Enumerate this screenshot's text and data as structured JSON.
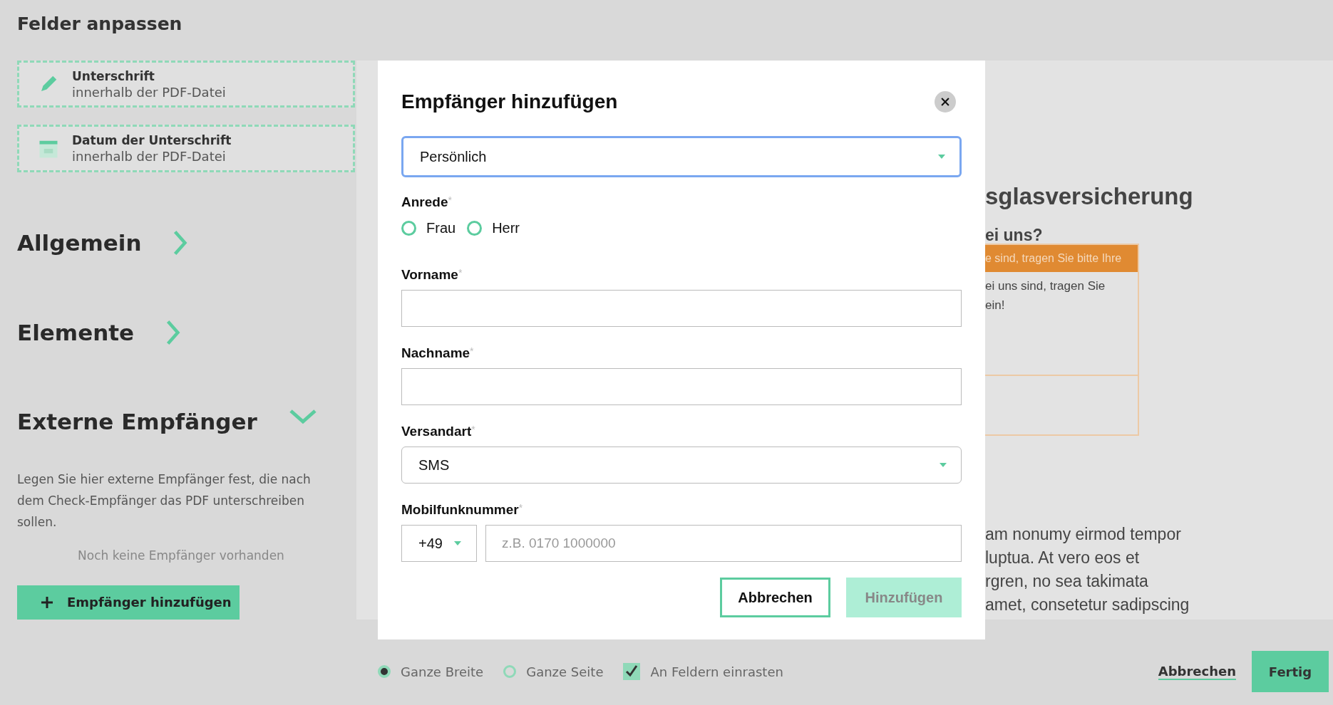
{
  "header": {
    "title": "Felder anpassen"
  },
  "field_cards": [
    {
      "kind": "signature",
      "title": "Unterschrift",
      "subtitle": "innerhalb der PDF-Datei"
    },
    {
      "kind": "date",
      "title": "Datum der Unterschrift",
      "subtitle": "innerhalb der PDF-Datei"
    }
  ],
  "sections": [
    {
      "title": "Allgemein",
      "expanded": false
    },
    {
      "title": "Elemente",
      "expanded": false
    },
    {
      "title": "Externe Empfänger",
      "expanded": true
    }
  ],
  "external_recipients": {
    "description": "Legen Sie hier externe Empfänger fest, die nach dem Check-Empfänger das PDF unterschreiben sollen.",
    "empty_text": "Noch keine Empfänger vorhanden",
    "add_button": "Empfänger hinzufügen"
  },
  "document": {
    "heading": "sglasversicherung",
    "question": "ei uns?",
    "banner": "e sind, tragen Sie bitte Ihre",
    "box_text": [
      "ei uns sind, tragen Sie",
      "ein!"
    ],
    "body_lines": [
      "am nonumy eirmod tempor",
      "luptua. At vero eos et",
      "rgren, no sea takimata",
      "amet, consetetur sadipscing"
    ]
  },
  "bottom_bar": {
    "view_options": [
      {
        "label": "Ganze Breite",
        "selected": true
      },
      {
        "label": "Ganze Seite",
        "selected": false
      }
    ],
    "snap": {
      "label": "An Feldern einrasten",
      "checked": true
    },
    "cancel": "Abbrechen",
    "done": "Fertig"
  },
  "modal": {
    "title": "Empfänger hinzufügen",
    "type_select": {
      "value": "Persönlich",
      "focused": true
    },
    "salutation": {
      "label": "Anrede",
      "required_mark": "*",
      "options": [
        {
          "label": "Frau",
          "selected": false
        },
        {
          "label": "Herr",
          "selected": false
        }
      ]
    },
    "first_name": {
      "label": "Vorname",
      "required_mark": "*"
    },
    "last_name": {
      "label": "Nachname",
      "required_mark": "*"
    },
    "delivery": {
      "label": "Versandart",
      "required_mark": "*",
      "value": "SMS"
    },
    "mobile": {
      "label": "Mobilfunknummer",
      "required_mark": "*",
      "country_code": "+49",
      "placeholder": "z.B. 0170 1000000"
    },
    "cancel": "Abbrechen",
    "submit": {
      "label": "Hinzufügen",
      "disabled": true
    }
  }
}
